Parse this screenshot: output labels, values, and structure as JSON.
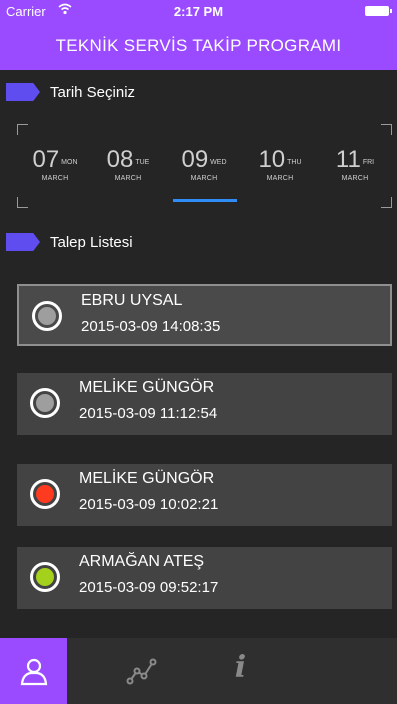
{
  "status_bar": {
    "carrier": "Carrier",
    "time": "2:17 PM",
    "wifi_icon": "wifi-icon",
    "battery_icon": "battery-icon"
  },
  "header": {
    "title": "TEKNİK SERVİS TAKİP PROGRAMI"
  },
  "date_section": {
    "label": "Tarih Seçiniz",
    "dates": [
      {
        "day": "07",
        "dayname": "MON",
        "month": "MARCH"
      },
      {
        "day": "08",
        "dayname": "TUE",
        "month": "MARCH"
      },
      {
        "day": "09",
        "dayname": "WED",
        "month": "MARCH",
        "selected": true
      },
      {
        "day": "10",
        "dayname": "THU",
        "month": "MARCH"
      },
      {
        "day": "11",
        "dayname": "FRI",
        "month": "MARCH"
      }
    ]
  },
  "list_section": {
    "label": "Talep Listesi",
    "items": [
      {
        "name": "EBRU UYSAL",
        "datetime": "2015-03-09 14:08:35",
        "status_color": "#9e9e9e",
        "selected": true
      },
      {
        "name": "MELİKE GÜNGÖR",
        "datetime": "2015-03-09 11:12:54",
        "status_color": "#9e9e9e"
      },
      {
        "name": "MELİKE GÜNGÖR",
        "datetime": "2015-03-09 10:02:21",
        "status_color": "#ff3b1f"
      },
      {
        "name": "ARMAĞAN ATEŞ",
        "datetime": "2015-03-09 09:52:17",
        "status_color": "#a3d11c"
      }
    ]
  },
  "tab_bar": {
    "tabs": [
      {
        "icon": "user-icon",
        "active": true
      },
      {
        "icon": "chart-line-icon",
        "active": false
      },
      {
        "icon": "info-icon",
        "symbol": "i",
        "active": false
      }
    ]
  },
  "colors": {
    "accent": "#9a4bff",
    "tag": "#5f4df0",
    "selected_underline": "#2f8df5",
    "background": "#252525",
    "card": "#434343"
  }
}
